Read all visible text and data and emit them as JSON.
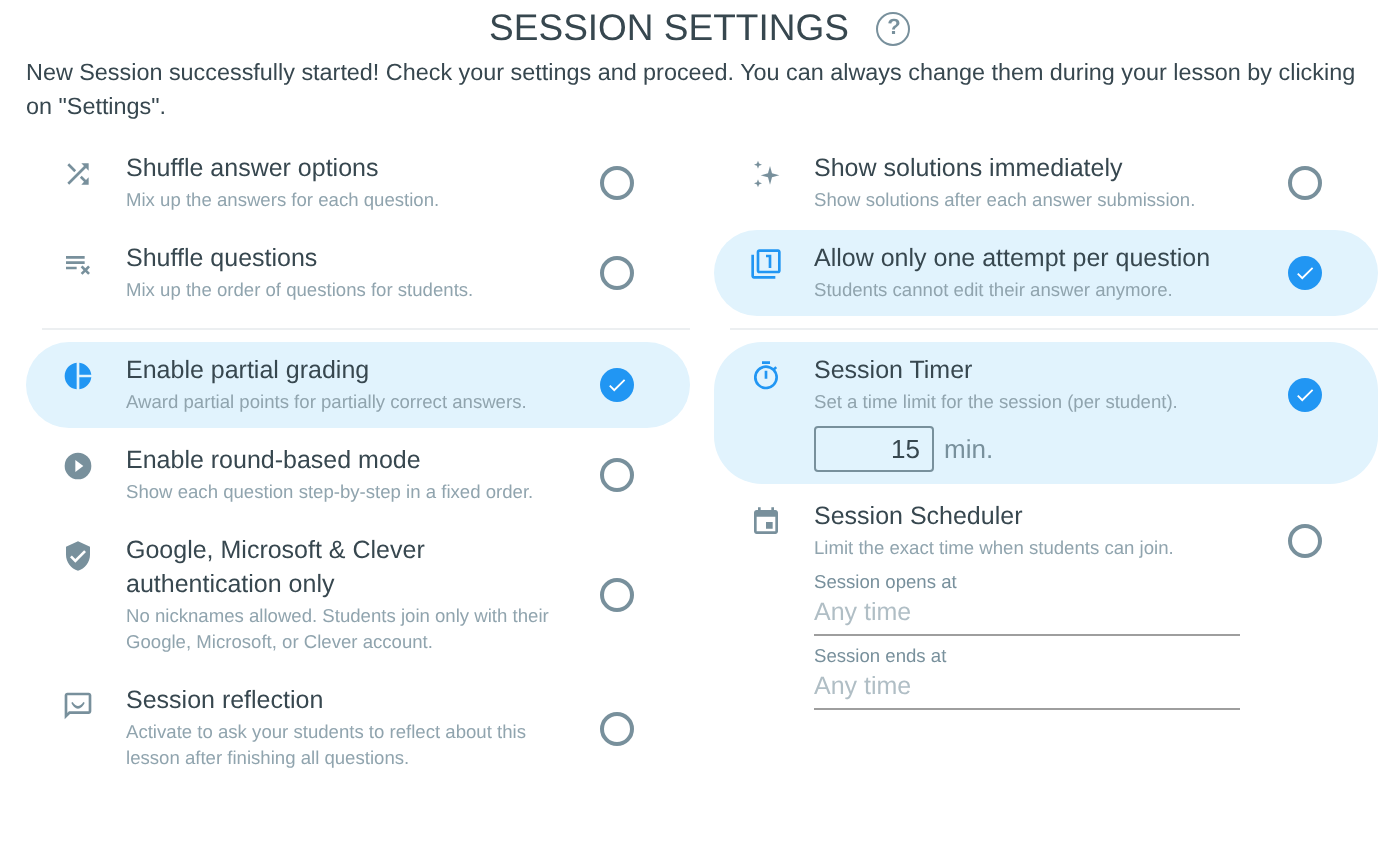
{
  "header": {
    "title": "SESSION SETTINGS",
    "help": "?"
  },
  "intro": "New Session successfully started! Check your settings and proceed. You can always change them during your lesson by clicking on \"Settings\".",
  "columns": [
    {
      "sections": [
        {
          "options": [
            {
              "kind": "toggle",
              "title": "Shuffle answer options",
              "description": "Mix up the answers for each question.",
              "checked": false
            },
            {
              "kind": "toggle",
              "title": "Shuffle questions",
              "description": "Mix up the order of questions for students.",
              "checked": false
            }
          ]
        },
        {
          "options": [
            {
              "kind": "toggle",
              "title": "Enable partial grading",
              "description": "Award partial points for partially correct answers.",
              "checked": true
            },
            {
              "kind": "toggle",
              "title": "Enable round-based mode",
              "description": "Show each question step-by-step in a fixed order.",
              "checked": false
            },
            {
              "kind": "toggle",
              "title": "Google, Microsoft & Clever authentication only",
              "description": "No nicknames allowed. Students join only with their Google, Microsoft, or Clever account.",
              "checked": false
            },
            {
              "kind": "toggle",
              "title": "Session reflection",
              "description": "Activate to ask your students to reflect about this lesson after finishing all questions.",
              "checked": false
            }
          ]
        }
      ]
    },
    {
      "sections": [
        {
          "options": [
            {
              "kind": "toggle",
              "title": "Show solutions immediately",
              "description": "Show solutions after each answer submission.",
              "checked": false
            },
            {
              "kind": "toggle",
              "title": "Allow only one attempt per question",
              "description": "Students cannot edit their answer anymore.",
              "checked": true
            }
          ]
        },
        {
          "options": [
            {
              "kind": "timer",
              "title": "Session Timer",
              "description": "Set a time limit for the session (per student).",
              "checked": true,
              "value": "15",
              "unit": "min."
            },
            {
              "kind": "scheduler",
              "title": "Session Scheduler",
              "description": "Limit the exact time when students can join.",
              "checked": false,
              "fields": [
                {
                  "label": "Session opens at",
                  "placeholder": "Any time"
                },
                {
                  "label": "Session ends at",
                  "placeholder": "Any time"
                }
              ]
            }
          ]
        }
      ]
    }
  ]
}
